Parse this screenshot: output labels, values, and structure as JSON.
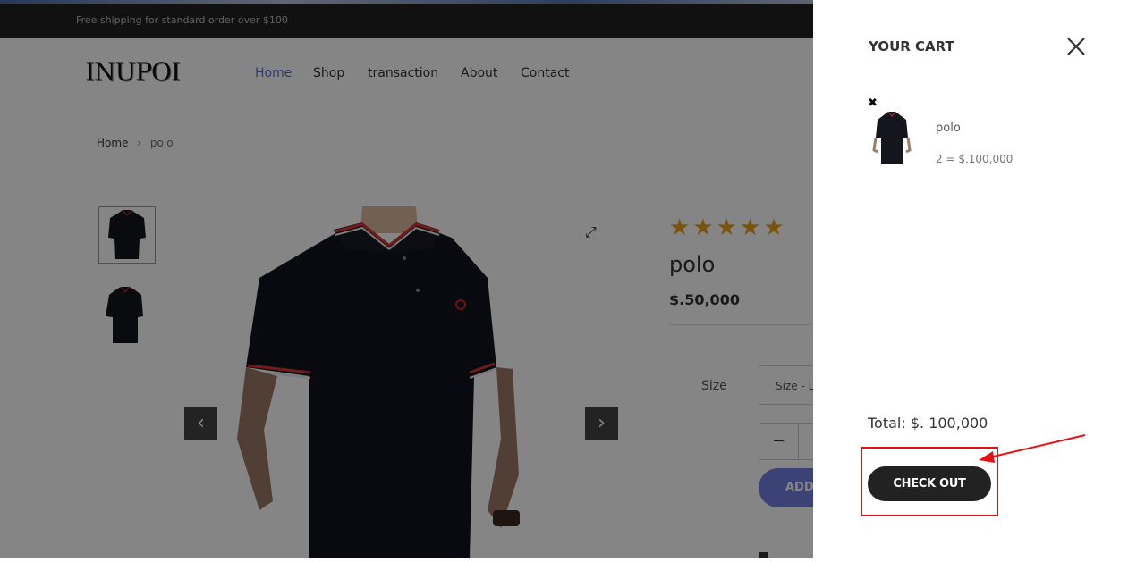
{
  "topbar": {
    "text": "Free shipping for standard order over $100"
  },
  "header": {
    "logo": "INUPOI",
    "nav": [
      "Home",
      "Shop",
      "transaction",
      "About",
      "Contact"
    ]
  },
  "breadcrumb": {
    "home": "Home",
    "sep": "›",
    "current": "polo"
  },
  "product": {
    "stars": "★★★★★",
    "title": "polo",
    "price": "$.50,000",
    "size_label": "Size",
    "size_value": "Size - L",
    "qty_minus": "−",
    "add_label": "ADD",
    "prev_arrow": "‹",
    "next_arrow": "›",
    "expand_glyph": "⤢"
  },
  "cart": {
    "title": "YOUR CART",
    "remove_glyph": "✖",
    "items": [
      {
        "name": "polo",
        "qty_price": "2 = $.100,000"
      }
    ],
    "total": "Total: $. 100,000",
    "checkout_label": "CHECK OUT"
  },
  "colors": {
    "accent": "#717fe0",
    "nav_active": "#5a6ed8",
    "star": "#e6a21c",
    "annotation": "#e41313"
  }
}
